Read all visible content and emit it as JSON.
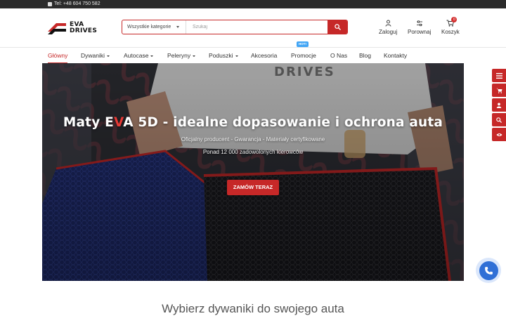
{
  "topbar": {
    "phone": "Tel: +48 604 750 582"
  },
  "brand": {
    "line1": "EVA",
    "line2": "DRIVES",
    "accent_color": "#c62828"
  },
  "search": {
    "category": "Wszystkie kategorie",
    "placeholder": "Szukaj",
    "icon": "search-icon"
  },
  "header_actions": [
    {
      "label": "Zaloguj",
      "icon": "user-icon"
    },
    {
      "label": "Porownaj",
      "icon": "sliders-icon"
    },
    {
      "label": "Koszyk",
      "icon": "cart-icon",
      "badge": "0"
    }
  ],
  "nav": {
    "items": [
      {
        "label": "Główny",
        "active": true
      },
      {
        "label": "Dywaniki",
        "dropdown": true
      },
      {
        "label": "Autocase",
        "dropdown": true
      },
      {
        "label": "Peleryny",
        "dropdown": true
      },
      {
        "label": "Poduszki",
        "dropdown": true
      },
      {
        "label": "Akcesoria"
      },
      {
        "label": "Promocje",
        "badge": "HOT!"
      },
      {
        "label": "O Nas"
      },
      {
        "label": "Blog"
      },
      {
        "label": "Kontakty"
      }
    ]
  },
  "hero": {
    "title_before": "Maty E",
    "title_accent": "V",
    "title_after": "A 5D - idealne dopasowanie i ochrona auta",
    "subtitle1": "Oficjalny producent - Gwarancja - Materiały certyfikowane",
    "subtitle2": "Ponad 12 000 zadowolonych kierowców",
    "cta": "ZAMÓW TERAZ",
    "shirt_print": "DRIVES"
  },
  "side_rail": [
    "menu-icon",
    "cart-icon",
    "user-icon",
    "search-icon",
    "eye-icon"
  ],
  "call_button": {
    "icon": "phone-icon"
  },
  "section": {
    "heading": "Wybierz dywaniki do swojego auta"
  }
}
